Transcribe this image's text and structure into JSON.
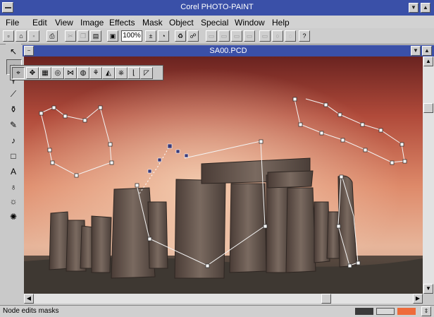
{
  "app": {
    "title": "Corel PHOTO-PAINT"
  },
  "menu": [
    "File",
    "Edit",
    "View",
    "Image",
    "Effects",
    "Mask",
    "Object",
    "Special",
    "Window",
    "Help"
  ],
  "toolbar": {
    "zoom": "100%"
  },
  "document": {
    "title": "SA00.PCD"
  },
  "status": {
    "text": "Node edits masks",
    "color_outline": "#3a3a3a",
    "color_fill": "#ee6b3a"
  },
  "colors": {
    "titlebar": "#3a50a8",
    "chrome": "#cdcdcd"
  },
  "icons": {
    "tools": [
      "pointer-icon",
      "node-edit-icon",
      "zoom-icon",
      "eyedropper-icon",
      "fill-icon",
      "brush-icon",
      "smear-icon",
      "rectangle-icon",
      "text-icon",
      "clone-icon",
      "effect-icon",
      "freehand-mask-icon"
    ],
    "flyout": [
      "node-edit-icon",
      "move-icon",
      "rectangle-mask-icon",
      "circle-mask-icon",
      "polygon-mask-icon",
      "freehand-mask-icon",
      "magic-wand-icon",
      "lasso-icon",
      "scissors-mask-icon",
      "brush-mask-icon",
      "eraser-mask-icon"
    ]
  }
}
